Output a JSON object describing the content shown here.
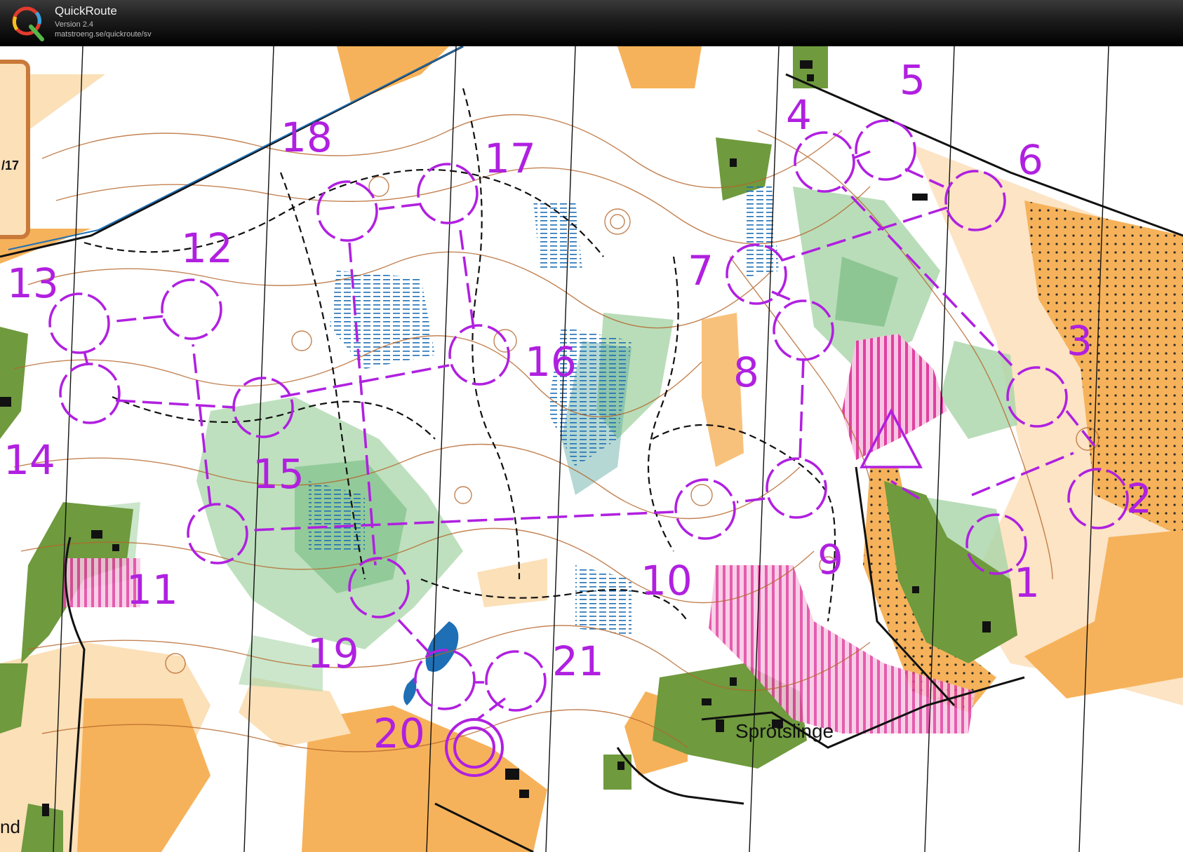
{
  "app": {
    "title": "QuickRoute",
    "version": "Version 2.4",
    "url": "matstroeng.se/quickroute/sv",
    "logo_icon": "quickroute-q-logo"
  },
  "map": {
    "colors": {
      "course": "#b020e0",
      "open_land": "#f6b25a",
      "forest_green": "#6f9a3e",
      "light_green": "#a8d5a8",
      "contour": "#b5652a",
      "marsh": "#1e6fb5",
      "restricted": "#e040a0"
    },
    "place_label": "Sprötslinge",
    "edge_labels": {
      "left_panel": "/17",
      "bottom_left": "nd"
    },
    "controls": [
      {
        "label": "1"
      },
      {
        "label": "2"
      },
      {
        "label": "3"
      },
      {
        "label": "4"
      },
      {
        "label": "5"
      },
      {
        "label": "6"
      },
      {
        "label": "7"
      },
      {
        "label": "8"
      },
      {
        "label": "9"
      },
      {
        "label": "10"
      },
      {
        "label": "11"
      },
      {
        "label": "12"
      },
      {
        "label": "13"
      },
      {
        "label": "14"
      },
      {
        "label": "15"
      },
      {
        "label": "16"
      },
      {
        "label": "17"
      },
      {
        "label": "18"
      },
      {
        "label": "19"
      },
      {
        "label": "20"
      },
      {
        "label": "21"
      }
    ]
  }
}
